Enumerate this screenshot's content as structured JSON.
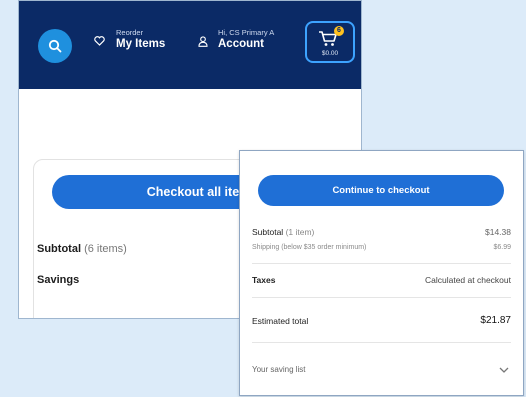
{
  "header": {
    "reorder_small": "Reorder",
    "reorder_label": "My Items",
    "account_small": "Hi, CS Primary A",
    "account_label": "Account",
    "cart_count": "6",
    "cart_total": "$0.00"
  },
  "cart_summary": {
    "checkout_label": "Checkout all items",
    "subtotal_label": "Subtotal",
    "subtotal_items": "(6 items)",
    "savings_label": "Savings"
  },
  "checkout_panel": {
    "continue_label": "Continue to checkout",
    "subtotal_label": "Subtotal",
    "subtotal_items": "(1 item)",
    "subtotal_value": "$14.38",
    "shipping_label": "Shipping (below $35 order minimum)",
    "shipping_value": "$6.99",
    "taxes_label": "Taxes",
    "taxes_value": "Calculated at checkout",
    "estimated_label": "Estimated total",
    "estimated_value": "$21.87",
    "savings_label": "Your saving list"
  },
  "colors": {
    "header_bg": "#0b2a66",
    "primary_button": "#1f6fd6",
    "cart_highlight": "#3da3ff",
    "badge": "#ffc220",
    "page_bg": "#dcebf9"
  },
  "icons": [
    "search-icon",
    "heart-icon",
    "user-icon",
    "cart-icon",
    "chevron-down-icon"
  ]
}
